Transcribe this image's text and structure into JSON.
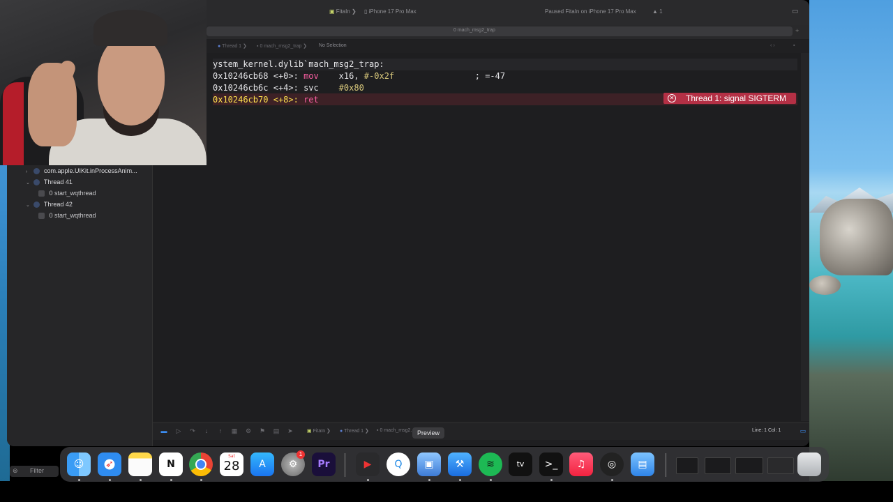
{
  "titlebar": {
    "scheme": "FitaIn",
    "device": "iPhone 17 Pro Max",
    "status": "Paused FitaIn on iPhone 17 Pro Max",
    "warning_count": "1"
  },
  "tab": {
    "label": "0 mach_msg2_trap"
  },
  "jumpbar": {
    "thread": "Thread 1",
    "frame": "0 mach_msg2_trap",
    "selection": "No Selection"
  },
  "navigator": {
    "rows": [
      {
        "label": "com.apple.UIKit.inProcessAnim...",
        "kind": "queue"
      },
      {
        "label": "Thread 41",
        "kind": "thread"
      },
      {
        "label": "0 start_wqthread",
        "kind": "frame"
      },
      {
        "label": "Thread 42",
        "kind": "thread"
      },
      {
        "label": "0 start_wqthread",
        "kind": "frame"
      }
    ],
    "filter_placeholder": "Filter"
  },
  "editor": {
    "header": "ystem_kernel.dylib`mach_msg2_trap:",
    "lines": [
      {
        "addr": "0x10246cb68",
        "off": "<+0>:",
        "op": "mov",
        "args": "x16, #-0x2f",
        "comment": "; =-47"
      },
      {
        "addr": "0x10246cb6c",
        "off": "<+4>:",
        "op": "svc",
        "args": "#0x80",
        "comment": ""
      },
      {
        "addr": "0x10246cb70",
        "off": "<+8>:",
        "op": "ret",
        "args": "",
        "comment": ""
      }
    ],
    "error_badge": "Thread 1: signal SIGTERM"
  },
  "debugbar": {
    "crumbs": [
      "FitaIn",
      "Thread 1",
      "0 mach_msg2..."
    ],
    "line_col": "Line: 1  Col: 1"
  },
  "dock": {
    "tooltip": "Preview",
    "calendar_month": "Sat",
    "calendar_day": "28",
    "settings_badge": "1",
    "apple_tv_label": "tv",
    "premiere_label": "Pr"
  },
  "colors": {
    "error": "#b43045",
    "keyword": "#fc5fa3",
    "number": "#d9c97c"
  }
}
